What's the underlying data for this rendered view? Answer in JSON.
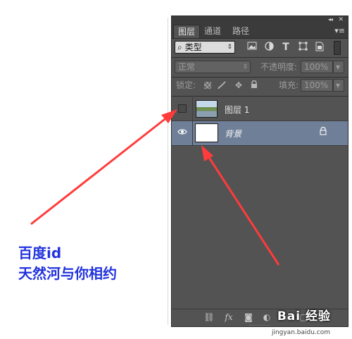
{
  "panel": {
    "collapse_glyph": "◂◂",
    "close_glyph": "✕",
    "menu_glyph": "▾≡",
    "tabs": [
      {
        "label": "图层",
        "active": true
      },
      {
        "label": "通道",
        "active": false
      },
      {
        "label": "路径",
        "active": false
      }
    ],
    "filter": {
      "search_glyph": "⌕",
      "label": "类型",
      "icons": [
        "image-filter-icon",
        "adjustment-filter-icon",
        "text-filter-icon",
        "shape-filter-icon",
        "smart-object-filter-icon"
      ],
      "text_icon_glyph": "T"
    },
    "blend_mode": "正常",
    "opacity_label": "不透明度:",
    "opacity_value": "100%",
    "lock_label": "锁定:",
    "fill_label": "填充:",
    "fill_value": "100%",
    "layers": [
      {
        "name": "图层 1",
        "visible": false,
        "thumbnail": "photo",
        "selected": false
      },
      {
        "name": "背景",
        "visible": true,
        "thumbnail": "white",
        "selected": true,
        "locked": true
      }
    ],
    "footer_icons": [
      "link-icon",
      "fx-icon",
      "mask-icon",
      "adjustment-icon",
      "group-icon",
      "new-layer-icon",
      "trash-icon"
    ],
    "fx_label": "fx"
  },
  "overlay": {
    "line1": "百度id",
    "line2": "天然河与你相约"
  },
  "watermark": {
    "brand": "Bai 经验",
    "url": "jingyan.baidu.com"
  },
  "colors": {
    "panel_bg": "#535353",
    "selected_layer": "#6f7f98",
    "arrow": "#ff3333",
    "overlay_text": "#2233dd"
  }
}
